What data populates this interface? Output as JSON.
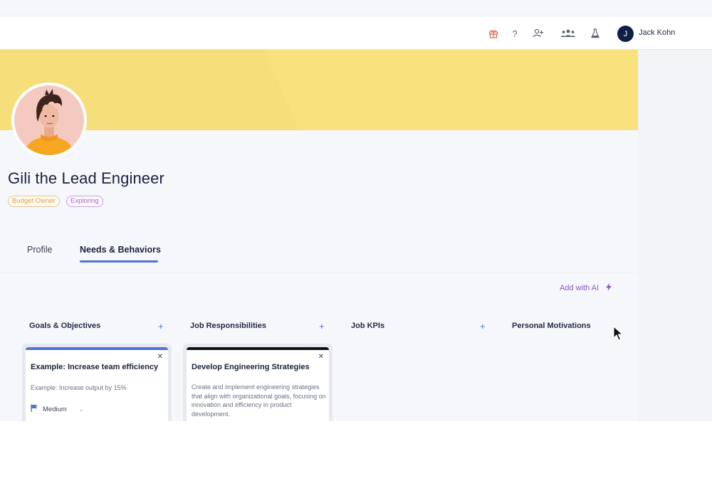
{
  "topbar": {
    "icons": [
      "gift-icon",
      "help-icon",
      "add-user-icon",
      "team-icon",
      "flask-icon"
    ],
    "user": {
      "initial": "J",
      "name": "Jack Kohn"
    }
  },
  "persona": {
    "title": "Gili the Lead Engineer",
    "tags": [
      {
        "label": "Budget Owner",
        "color": "#d9a24a"
      },
      {
        "label": "Exploring",
        "color": "#a46ac1"
      }
    ]
  },
  "tabs": [
    {
      "label": "Profile",
      "active": false
    },
    {
      "label": "Needs & Behaviors",
      "active": true
    }
  ],
  "add_with_ai": "Add with AI",
  "columns": [
    {
      "title": "Goals & Objectives",
      "cards": [
        {
          "title": "Example: Increase team efficiency",
          "description": "Example: Increase output by 15%",
          "priority": "Medium",
          "accent": "#4f73d6"
        }
      ]
    },
    {
      "title": "Job Responsibilities",
      "cards": [
        {
          "title": "Develop Engineering Strategies",
          "description": "Create and implement engineering strategies that align with organizational goals, focusing on innovation and efficiency in product development.",
          "accent": "#111111"
        }
      ]
    },
    {
      "title": "Job KPIs",
      "cards": []
    },
    {
      "title": "Personal Motivations",
      "cards": []
    }
  ],
  "colors": {
    "banner": "#f6df7a",
    "accent": "#4f73d6",
    "ai": "#8a55c9"
  }
}
